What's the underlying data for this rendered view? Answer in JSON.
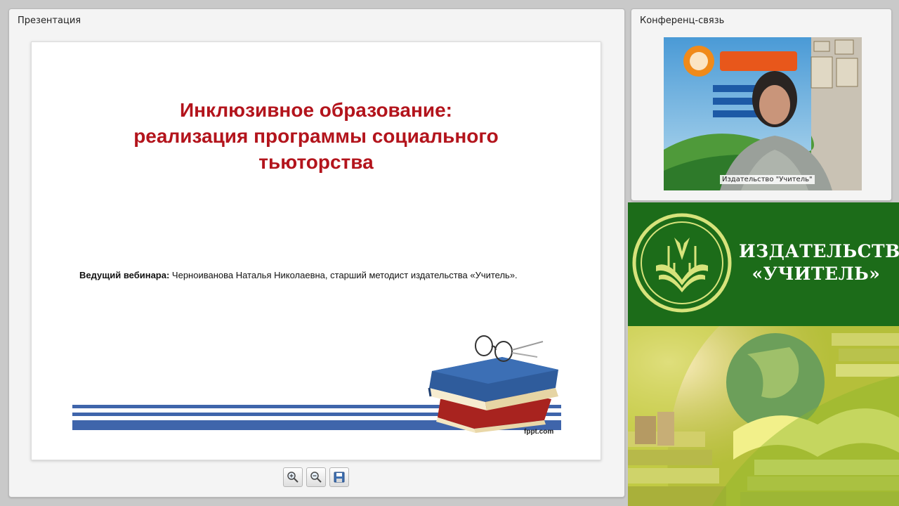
{
  "presentation_panel": {
    "title": "Презентация",
    "slide": {
      "title_lines": [
        "Инклюзивное образование:",
        "реализация программы социального",
        "тьюторства"
      ],
      "presenter_label": "Ведущий вебинара:",
      "presenter_text": " Черноиванова Наталья Николаевна, старший методист издательства «Учитель».",
      "footer_credit": "fppt.com"
    },
    "toolbar": {
      "zoom_in_icon": "zoom-in-icon",
      "zoom_out_icon": "zoom-out-icon",
      "save_icon": "save-icon"
    }
  },
  "conference_panel": {
    "title": "Конференц-связь",
    "video_caption": "Издательство \"Учитель\""
  },
  "publisher_banner": {
    "line1": "ИЗДАТЕЛЬСТВО",
    "line2": "«УЧИТЕЛЬ»"
  },
  "colors": {
    "slide_title": "#b3141c",
    "stripe_blue": "#3f65ab",
    "banner_green": "#1c6c19",
    "logo_lime": "#d7e37b"
  }
}
